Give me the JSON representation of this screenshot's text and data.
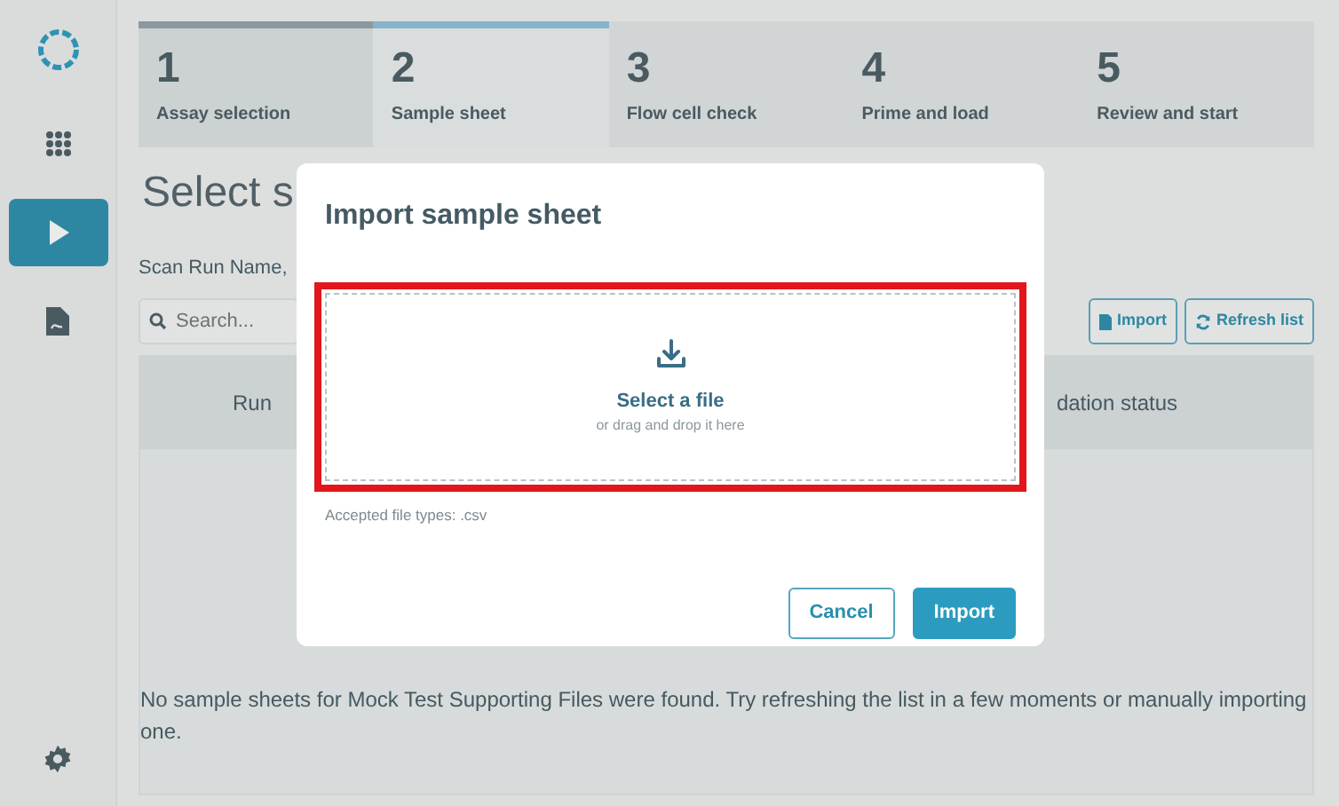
{
  "sidebar": {
    "items": [
      {
        "selected": false
      },
      {
        "selected": true
      },
      {
        "selected": false
      }
    ]
  },
  "steps": [
    {
      "number": "1",
      "label": "Assay selection",
      "completed": true,
      "selected": false
    },
    {
      "number": "2",
      "label": "Sample sheet",
      "completed": false,
      "selected": true
    },
    {
      "number": "3",
      "label": "Flow cell check",
      "completed": false,
      "selected": false
    },
    {
      "number": "4",
      "label": "Prime and load",
      "completed": false,
      "selected": false
    },
    {
      "number": "5",
      "label": "Review and start",
      "completed": false,
      "selected": false
    }
  ],
  "page": {
    "title": "Select s",
    "hint": "Scan Run Name,",
    "search": {
      "placeholder": "Search..."
    },
    "buttons": [
      {
        "label": "Import"
      },
      {
        "label": "Refresh list"
      }
    ],
    "table": {
      "columns": [
        "Run",
        "dation status"
      ]
    },
    "empty_message": "No sample sheets for Mock Test Supporting Files were found. Try refreshing the list in a few moments or manually importing one."
  },
  "modal": {
    "title": "Import sample sheet",
    "dropzone": {
      "title": "Select a file",
      "subtitle": "or drag and drop it here",
      "highlighted": true
    },
    "note": "Accepted file types: .csv",
    "buttons": [
      {
        "label": "Cancel",
        "kind": "outline"
      },
      {
        "label": "Import",
        "kind": "primary"
      }
    ]
  }
}
